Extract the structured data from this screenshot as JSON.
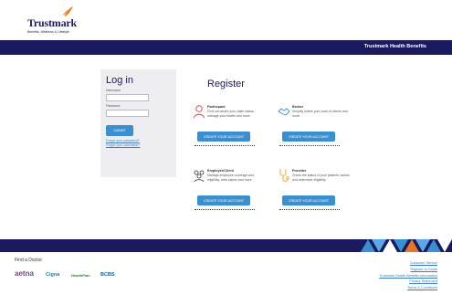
{
  "header": {
    "brand": "Trustmark",
    "tagline": "Benefits, Wellness & Lifestyle",
    "nav_title": "Trustmark Health Benefits"
  },
  "login": {
    "title": "Log in",
    "username_label": "Username",
    "password_label": "Password",
    "submit_label": "SUBMIT",
    "forgot_password": "Forgot your password?",
    "forgot_username": "Forgot your username?"
  },
  "register": {
    "title": "Register",
    "cards": [
      {
        "title": "Participant",
        "desc": "Find out what's your claim status, manage your health and more.",
        "button": "CREATE YOUR ACCOUNT"
      },
      {
        "title": "Broker",
        "desc": "Simplify where your book of clients and more.",
        "button": "CREATE YOUR ACCOUNT"
      },
      {
        "title": "Employer/Client",
        "desc": "Manage employee coverage and eligibility, view claims and more.",
        "button": "CREATE YOUR ACCOUNT"
      },
      {
        "title": "Provider",
        "desc": "Check the status of your patients' claims and determine eligibility.",
        "button": "CREATE YOUR ACCOUNT"
      }
    ]
  },
  "footer": {
    "find_doctor": "Find a Doctor",
    "partners": [
      "aetna",
      "Cigna",
      "HealthPlan",
      "BCBS"
    ],
    "links": [
      "Customer Service",
      "Register to Guide",
      "Trustmark Health Benefits Information",
      "Privacy Statement",
      "Terms & Conditions"
    ]
  },
  "colors": {
    "navy": "#1c1a5e",
    "button_blue": "#3a8fd0",
    "link_blue": "#3a7fc4",
    "aetna": "#7d3f98"
  }
}
